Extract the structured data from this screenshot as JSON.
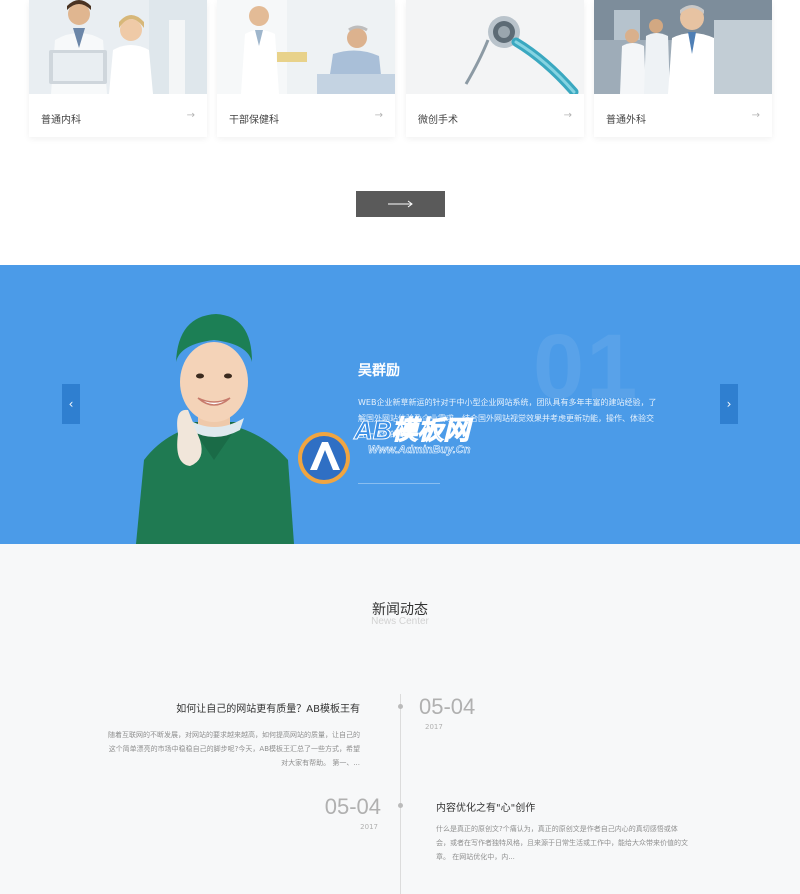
{
  "departments": [
    {
      "name": "普通内科",
      "arrow": "→",
      "photo": "doctors-with-laptop-photo"
    },
    {
      "name": "干部保健科",
      "arrow": "→",
      "photo": "doctor-with-patient-photo"
    },
    {
      "name": "微创手术",
      "arrow": "→",
      "photo": "stethoscope-photo"
    },
    {
      "name": "普通外科",
      "arrow": "→",
      "photo": "medical-team-photo"
    }
  ],
  "more_button": {
    "icon": "long-arrow-right-icon"
  },
  "banner": {
    "number": "01",
    "doctor_name": "吴群励",
    "description": "WEB企业新草新运的针对于中小型企业网站系统，团队具有多年丰富的建站经验，了解国外网站体验及企业需求，结合国外网站视觉效果并考虑更新功能，操作、体验交互一体化的专业",
    "prev_icon": "‹",
    "next_icon": "›",
    "colors": {
      "background": "#4b9be8",
      "slide_button": "#2f7fd0"
    }
  },
  "watermark": {
    "brand": "AB模板网",
    "url": "Www.AdminBuy.Cn"
  },
  "news": {
    "title": "新闻动态",
    "subtitle": "News Center",
    "items": [
      {
        "title": "如何让自己的网站更有质量？AB模板王有",
        "description": "随着互联网的不断发展，对网站的要求越来越高，如何提高网站的质量，让自己的这个简单漂亮的市场中稳稳自己的脚步呢?今天，AB模板王汇总了一些方式，希望对大家有帮助。 第一、...",
        "date": "05-04",
        "year": "2017"
      },
      {
        "title": "内容优化之有\"心\"创作",
        "description": "什么是真正的原创文?个痛认为，真正的原创文是作者自己内心的真切感悟或体会，或者在写作者独特风格，且来源于日常生活或工作中，能给大众带来价值的文章。 在网站优化中，内...",
        "date": "05-04",
        "year": "2017"
      }
    ]
  }
}
